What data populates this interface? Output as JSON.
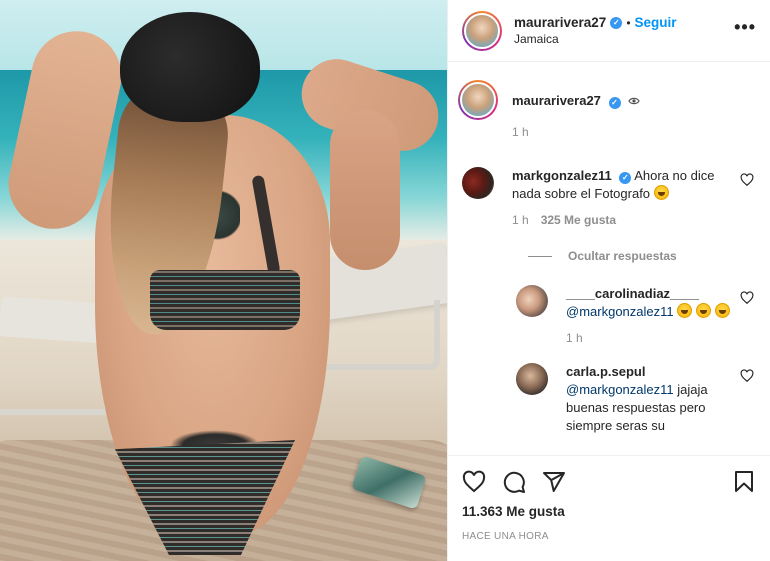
{
  "header": {
    "username": "maurarivera27",
    "separator": "•",
    "follow_label": "Seguir",
    "location": "Jamaica",
    "more_icon": "more-horizontal-icon"
  },
  "caption": {
    "username": "maurarivera27",
    "time": "1 h"
  },
  "comments": [
    {
      "username": "markgonzalez11",
      "text": "Ahora no dice nada sobre el Fotografo",
      "time": "1 h",
      "likes": "325 Me gusta",
      "toggle_label": "Ocultar respuestas"
    }
  ],
  "replies": [
    {
      "username": "____carolinadiaz____",
      "mention": "@markgonzalez11",
      "text": "",
      "time": "1 h"
    },
    {
      "username": "carla.p.sepul",
      "mention": "@markgonzalez11",
      "text": "jajaja buenas respuestas pero siempre seras su"
    }
  ],
  "footer": {
    "likes": "11.363 Me gusta",
    "time": "HACE UNA HORA"
  },
  "colors": {
    "link": "#0095f6",
    "verified": "#3897f0",
    "muted": "#8e8e8e",
    "text": "#262626"
  }
}
